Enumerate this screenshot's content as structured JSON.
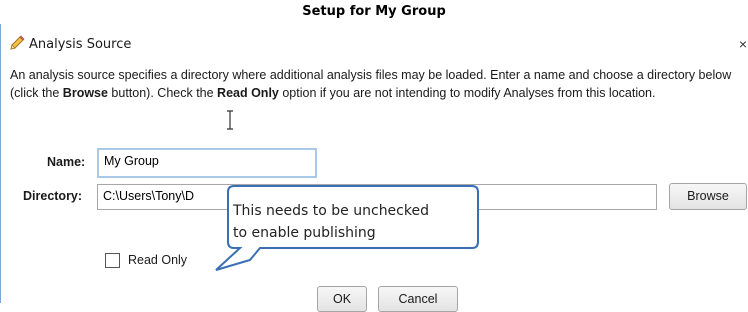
{
  "heading": "Setup for My Group",
  "dialog": {
    "title": "Analysis Source",
    "close_glyph": "×",
    "description": {
      "p1": "An analysis source specifies a directory where additional analysis files may be loaded. Enter a name and choose a directory below (click the ",
      "b1": "Browse",
      "p2": " button). Check the ",
      "b2": "Read Only",
      "p3": " option if you are not intending to modify Analyses from this location."
    },
    "name_label": "Name:",
    "name_value": "My Group",
    "directory_label": "Directory:",
    "directory_value": "C:\\Users\\Tony\\D",
    "browse_label": "Browse",
    "readonly_label": "Read Only",
    "readonly_checked": false,
    "ok_label": "OK",
    "cancel_label": "Cancel"
  },
  "callout": {
    "line1": "This needs to be unchecked",
    "line2": "to enable publishing"
  },
  "colors": {
    "dialog_border": "#7ea6d6",
    "callout_border": "#3a6fb5",
    "focus_border": "#a9c9ea"
  },
  "icons": {
    "title": "pencil-icon",
    "cursor": "text-cursor-icon"
  }
}
